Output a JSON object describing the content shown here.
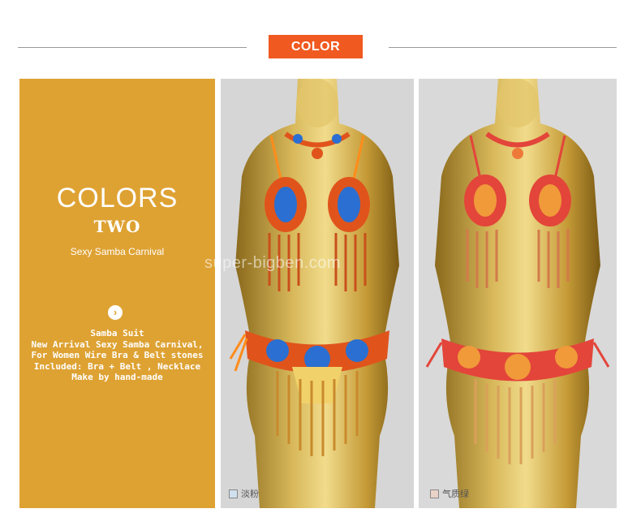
{
  "header": {
    "badge_label": "COLOR"
  },
  "side_panel": {
    "title_line1": "COLORS",
    "title_line2": "TWO",
    "subtitle": "Sexy Samba Carnival",
    "arrow_icon": "chevron-right-circle-icon",
    "description": [
      "Samba Suit",
      "New Arrival Sexy Samba Carnival,",
      "For Women Wire Bra & Belt stones",
      "Included: Bra + Belt , Necklace",
      "Make by hand-made"
    ],
    "background_color": "#deA233"
  },
  "products": [
    {
      "caption": "淡粉",
      "swatch_color": "#cfe0ee"
    },
    {
      "caption": "气质绿",
      "swatch_color": "#e9d2c8"
    }
  ],
  "watermark": "super-bigben.com",
  "colors": {
    "accent": "#f0591f",
    "gold": "#c9a23a"
  }
}
